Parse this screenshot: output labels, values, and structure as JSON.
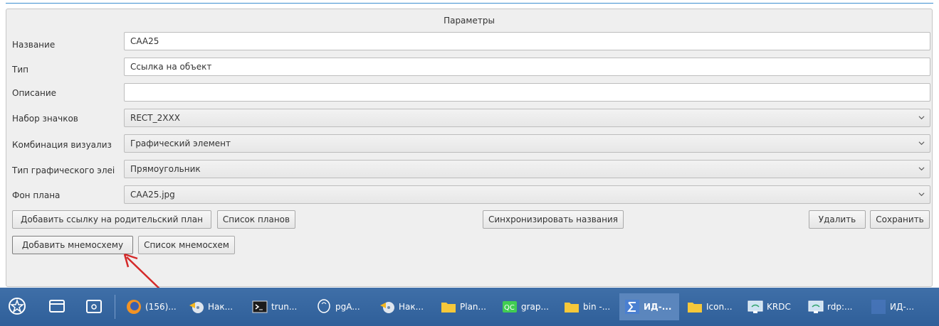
{
  "dialog": {
    "title": "Параметры",
    "fields": [
      {
        "label": "Название",
        "value": "CAA25",
        "kind": "text"
      },
      {
        "label": "Тип",
        "value": "Ссылка на объект",
        "kind": "text"
      },
      {
        "label": "Описание",
        "value": "",
        "kind": "text"
      },
      {
        "label": "Набор значков",
        "value": "RECT_2XXX",
        "kind": "combo"
      },
      {
        "label": "Комбинация визуализ",
        "value": "Графический элемент",
        "kind": "combo"
      },
      {
        "label": "Тип графического элеі",
        "value": "Прямоугольник",
        "kind": "combo"
      },
      {
        "label": "Фон плана",
        "value": "CAA25.jpg",
        "kind": "combo"
      }
    ],
    "buttons": {
      "add_parent_link": "Добавить ссылку на родительский план",
      "plan_list": "Список планов",
      "sync_names": "Синхронизировать названия",
      "delete": "Удалить",
      "save": "Сохранить",
      "add_mnemo": "Добавить мнемосхему",
      "mnemo_list": "Список мнемосхем"
    },
    "annotation_arrow_color": "#d42a2a"
  },
  "taskbar": {
    "background": "#3a69a3",
    "launchers": [
      "start-menu-icon",
      "window-manager-icon",
      "show-desktop-icon"
    ],
    "tasks": [
      {
        "label": "(156)...",
        "icon": "firefox-icon"
      },
      {
        "label": "Нак...",
        "icon": "disk-burner-icon"
      },
      {
        "label": "trun...",
        "icon": "terminal-icon"
      },
      {
        "label": "pgA...",
        "icon": "pgadmin-icon"
      },
      {
        "label": "Нак...",
        "icon": "disk-burner-icon"
      },
      {
        "label": "Plan...",
        "icon": "folder-icon"
      },
      {
        "label": "grap...",
        "icon": "qtcreator-icon"
      },
      {
        "label": "bin -...",
        "icon": "folder-icon"
      },
      {
        "label": "ИД-...",
        "icon": "sigma-app-icon",
        "active": true
      },
      {
        "label": "Icon...",
        "icon": "folder-icon"
      },
      {
        "label": "KRDC",
        "icon": "remote-desktop-icon"
      },
      {
        "label": "rdp:...",
        "icon": "remote-desktop-icon"
      },
      {
        "label": "ИД-...",
        "icon": "sigma-app-icon"
      }
    ]
  }
}
